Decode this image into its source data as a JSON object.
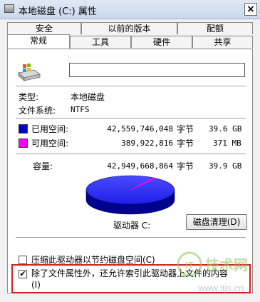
{
  "window": {
    "title": "本地磁盘 (C:) 属性",
    "close_glyph": "×"
  },
  "tabs_top": [
    "安全",
    "以前的版本",
    "配额"
  ],
  "tabs_bottom": [
    "常规",
    "工具",
    "硬件",
    "共享"
  ],
  "active_tab": "常规",
  "general": {
    "name_value": "",
    "type_label": "类型:",
    "type_value": "本地磁盘",
    "fs_label": "文件系统:",
    "fs_value": "NTFS",
    "used": {
      "label": "已用空间:",
      "bytes": "42,559,746,048",
      "unit": "字节",
      "size": "39.6 GB",
      "color": "#0000c8"
    },
    "free": {
      "label": "可用空间:",
      "bytes": "389,922,816",
      "unit": "字节",
      "size": "371 MB",
      "color": "#ff00ff"
    },
    "capacity": {
      "label": "容量:",
      "bytes": "42,949,668,864",
      "unit": "字节",
      "size": "39.9 GB"
    },
    "used_fraction": 0.991,
    "drive_label": "驱动器 C:",
    "cleanup_button": "磁盘清理(D)",
    "compress_label": "压缩此驱动器以节约磁盘空间(C)",
    "compress_checked": false,
    "index_label_line1": "除了文件属性外，还允许索引此驱动器上文件的内容",
    "index_label_line2": "(I)",
    "index_checked": true,
    "check_glyph": "✔"
  },
  "watermark": {
    "logo_char": "IT",
    "brand": "技术网",
    "url": "www.itjs.cn"
  }
}
